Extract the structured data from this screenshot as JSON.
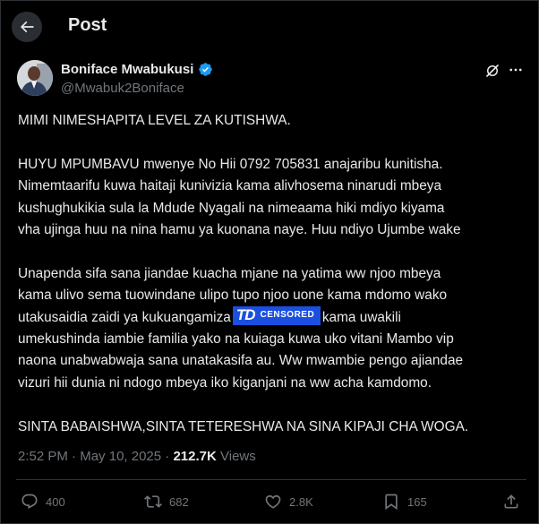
{
  "header": {
    "title": "Post",
    "back_icon": "arrow-left-icon"
  },
  "author": {
    "name": "Boniface Mwabukusi",
    "handle": "@Mwabuk2Boniface",
    "verified": true,
    "verified_color": "#1d9bf0"
  },
  "post": {
    "lines": {
      "l1": "MIMI NIMESHAPITA LEVEL ZA KUTISHWA.",
      "l2": "HUYU MPUMBAVU mwenye No Hii 0792 705831 anajaribu kunitisha.",
      "l3": "Nimemtaarifu kuwa haitaji kunivizia kama alivhosema ninarudi mbeya",
      "l4": "kushughukikia sula la Mdude Nyagali na nimeaama hiki mdiyo kiyama",
      "l5": "vha ujinga huu  na nina hamu ya kuonana naye. Huu ndiyo Ujumbe wake",
      "l6": "Unapenda sifa sana jiandae kuacha mjane na yatima ww njoo mbeya",
      "l7": "kama ulivo sema tuowindane ulipo tupo njoo uone kama mdomo wako",
      "l8a": "utakusaidia zaidi ya kukuangamiza",
      "l8b": "kama uwakili",
      "l9": "umekushinda iambie familia yako na kuiaga kuwa uko vitani Mambo vip",
      "l10": "naona unabwabwaja sana unatakasifa au. Ww mwambie pengo ajiandae",
      "l11": "vizuri hii dunia ni ndogo mbeya iko kiganjani na ww acha kamdomo.",
      "l12": "SINTA BABAISHWA,SINTA TETERESHWA NA SINA KIPAJI CHA WOGA."
    },
    "watermark": {
      "logo": "TD",
      "label": "CENSORED",
      "color": "#1a4fe0"
    }
  },
  "meta": {
    "time": "2:52 PM",
    "sep": " · ",
    "date": "May 10, 2025",
    "sep2": " · ",
    "views_count": "212.7K",
    "views_label": " Views"
  },
  "actions": {
    "replies": "400",
    "reposts": "682",
    "likes": "2.8K",
    "bookmarks": "165"
  },
  "colors": {
    "background": "#000000",
    "text": "#e7e9ea",
    "muted": "#71767b",
    "border": "#2f3336"
  }
}
